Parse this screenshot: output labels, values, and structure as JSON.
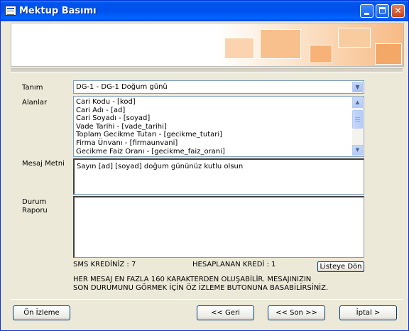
{
  "window": {
    "title": "Mektup Basımı"
  },
  "colors": {
    "titlebar": "#0054E3",
    "window_bg": "#ECE9D8",
    "banner_accent": "#F6B277"
  },
  "form": {
    "tanim_label": "Tanım",
    "tanim_value": "DG-1 - DG-1  Doğum günü",
    "alanlar_label": "Alanlar",
    "alanlar_items": [
      "Cari Kodu - [kod]",
      "Cari Adı - [ad]",
      "Cari Soyadı - [soyad]",
      "Vade Tarihi - [vade_tarihi]",
      "Toplam Gecikme Tutarı - [gecikme_tutari]",
      "Firma Ünvanı - [firmaunvani]",
      "Gecikme Faiz Oranı - [gecikme_faiz_orani]"
    ],
    "mesaj_label": "Mesaj Metni",
    "mesaj_value": "Sayın [ad] [soyad] doğum gününüz kutlu olsun",
    "durum_label_1": "Durum",
    "durum_label_2": "Raporu",
    "durum_value": ""
  },
  "info": {
    "sms_kredi": "SMS KREDİNİZ : 7",
    "hesaplanan_kredi": "HESAPLANAN KREDİ : 1",
    "listeye_don": "Listeye Dön",
    "notice_line1": "HER MESAJ EN FAZLA 160 KARAKTERDEN OLUŞABİLİR. MESAJINIZIN",
    "notice_line2": "SON DURUMUNU GÖRMEK İÇİN ÖZ İZLEME BUTONUNA BASABİLİRSİNİZ."
  },
  "buttons": {
    "on_izleme": "Ön İzleme",
    "geri": "<< Geri",
    "son": "<< Son >>",
    "iptal": "İptal >"
  },
  "icons": [
    "app-window-icon",
    "minimize-icon",
    "maximize-icon",
    "close-icon",
    "dropdown-arrow-icon",
    "scroll-up-icon",
    "scroll-down-icon"
  ]
}
